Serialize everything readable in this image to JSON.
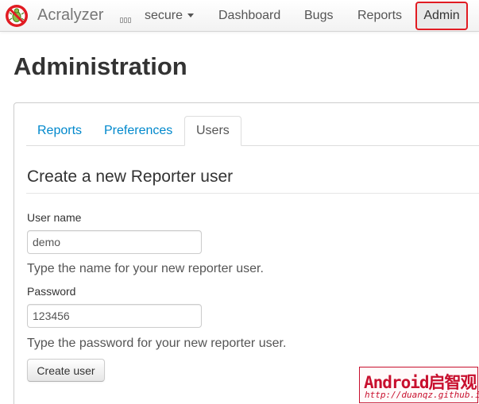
{
  "navbar": {
    "logo_icon": "acralyzer-bug-logo-icon",
    "brand": "Acralyzer",
    "server_icon": "server-icon",
    "secure": "secure",
    "dashboard": "Dashboard",
    "bugs": "Bugs",
    "reports": "Reports",
    "admin": "Admin",
    "accent_color": "#e11b22"
  },
  "page": {
    "title": "Administration"
  },
  "tabs": [
    {
      "label": "Reports",
      "active": false
    },
    {
      "label": "Preferences",
      "active": false
    },
    {
      "label": "Users",
      "active": true
    }
  ],
  "form": {
    "title": "Create a new Reporter user",
    "username_label": "User name",
    "username_value": "demo",
    "username_help": "Type the name for your new reporter user.",
    "password_label": "Password",
    "password_value": "123456",
    "password_help": "Type the password for your new reporter user.",
    "submit_label": "Create user"
  },
  "watermark": {
    "main": "Android启智观",
    "url": "http://duanqz.github.io"
  },
  "colors": {
    "link": "#0088cc",
    "watermark": "#c8102e"
  }
}
